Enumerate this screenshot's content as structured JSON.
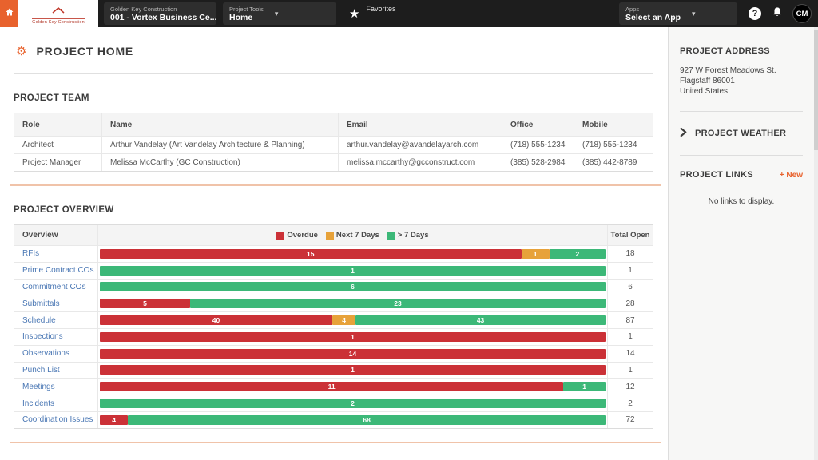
{
  "topbar": {
    "logo_text": "Golden Key Construction",
    "company_selector": {
      "label": "Golden Key Construction",
      "value": "001 - Vortex Business Ce..."
    },
    "tool_selector": {
      "label": "Project Tools",
      "value": "Home"
    },
    "favorites_label": "Favorites",
    "apps_selector": {
      "label": "Apps",
      "value": "Select an App"
    },
    "help_glyph": "?",
    "avatar_initials": "CM"
  },
  "page": {
    "title": "PROJECT HOME"
  },
  "team": {
    "heading": "PROJECT TEAM",
    "columns": {
      "role": "Role",
      "name": "Name",
      "email": "Email",
      "office": "Office",
      "mobile": "Mobile"
    },
    "rows": [
      {
        "role": "Architect",
        "name": "Arthur Vandelay (Art Vandelay Architecture & Planning)",
        "email": "arthur.vandelay@avandelayarch.com",
        "office": "(718) 555-1234",
        "mobile": "(718) 555-1234"
      },
      {
        "role": "Project Manager",
        "name": "Melissa McCarthy (GC Construction)",
        "email": "melissa.mccarthy@gcconstruct.com",
        "office": "(385) 528-2984",
        "mobile": "(385) 442-8789"
      }
    ]
  },
  "overview": {
    "heading": "PROJECT OVERVIEW",
    "col_overview": "Overview",
    "col_total": "Total Open",
    "legend": [
      {
        "key": "overdue",
        "label": "Overdue",
        "color": "#cb3137"
      },
      {
        "key": "next7",
        "label": "Next 7 Days",
        "color": "#e7a23a"
      },
      {
        "key": "gt7",
        "label": "> 7 Days",
        "color": "#3cb878"
      }
    ],
    "rows": [
      {
        "label": "RFIs",
        "overdue": 15,
        "next7": 1,
        "gt7": 2,
        "total": 18
      },
      {
        "label": "Prime Contract COs",
        "overdue": 0,
        "next7": 0,
        "gt7": 1,
        "total": 1
      },
      {
        "label": "Commitment COs",
        "overdue": 0,
        "next7": 0,
        "gt7": 6,
        "total": 6
      },
      {
        "label": "Submittals",
        "overdue": 5,
        "next7": 0,
        "gt7": 23,
        "total": 28
      },
      {
        "label": "Schedule",
        "overdue": 40,
        "next7": 4,
        "gt7": 43,
        "total": 87
      },
      {
        "label": "Inspections",
        "overdue": 1,
        "next7": 0,
        "gt7": 0,
        "total": 1
      },
      {
        "label": "Observations",
        "overdue": 14,
        "next7": 0,
        "gt7": 0,
        "total": 14
      },
      {
        "label": "Punch List",
        "overdue": 1,
        "next7": 0,
        "gt7": 0,
        "total": 1
      },
      {
        "label": "Meetings",
        "overdue": 11,
        "next7": 0,
        "gt7": 1,
        "total": 12
      },
      {
        "label": "Incidents",
        "overdue": 0,
        "next7": 0,
        "gt7": 2,
        "total": 2
      },
      {
        "label": "Coordination Issues",
        "overdue": 4,
        "next7": 0,
        "gt7": 68,
        "total": 72
      }
    ]
  },
  "sidebar": {
    "address_heading": "PROJECT ADDRESS",
    "address_line1": "927 W Forest Meadows St.",
    "address_line2": "Flagstaff 86001",
    "address_line3": "United States",
    "weather_heading": "PROJECT WEATHER",
    "links_heading": "PROJECT LINKS",
    "new_link_label": "+ New",
    "links_empty_text": "No links to display."
  },
  "colors": {
    "accent": "#e8622d",
    "overdue": "#cb3137",
    "next7": "#e7a23a",
    "gt7": "#3cb878",
    "link_blue": "#4a77b4"
  }
}
